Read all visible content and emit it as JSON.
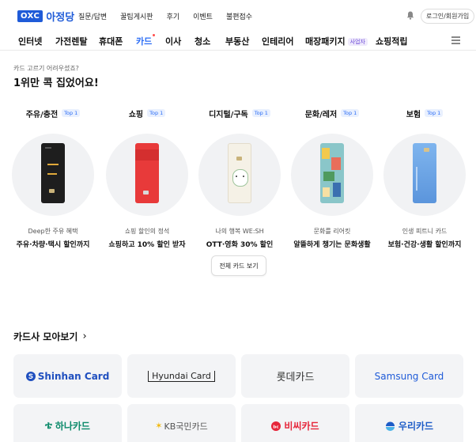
{
  "header": {
    "logo_mark": "OXC",
    "logo_name": "아정당",
    "nav": [
      "질문/답변",
      "꿀팁게시판",
      "후기",
      "이벤트",
      "불편접수"
    ],
    "login_label": "로그인/회원가입"
  },
  "categories": [
    {
      "label": "인터넷"
    },
    {
      "label": "가전렌탈"
    },
    {
      "label": "휴대폰"
    },
    {
      "label": "카드"
    },
    {
      "label": "이사"
    },
    {
      "label": "청소"
    },
    {
      "label": "부동산"
    },
    {
      "label": "인테리어"
    },
    {
      "label": "매장패키지",
      "badge": "사업자"
    },
    {
      "label": "쇼핑적립"
    }
  ],
  "intro": {
    "sub": "카드 고르기 어려우셨죠?",
    "headline": "1위만 콕 집었어요!"
  },
  "top_badge": "Top 1",
  "cards": [
    {
      "category": "주유/충전",
      "desc": "Deep한 주유 혜택",
      "name": "주유·차량·택시 할인까지",
      "card_color": "#1e1e1e"
    },
    {
      "category": "쇼핑",
      "desc": "쇼핑 할인의 정석",
      "name": "쇼핑하고 10% 할인 받자",
      "card_color": "#e83a3a"
    },
    {
      "category": "디지털/구독",
      "desc": "나의 행복 WE:SH",
      "name": "OTT·영화 30% 할인",
      "card_color": "#f5f1e6"
    },
    {
      "category": "문화/레저",
      "desc": "문화를 리어킷",
      "name": "알뜰하게 챙기는 문화생활",
      "card_color": "#8ac6c9"
    },
    {
      "category": "보험",
      "desc": "인생 피트니 카드",
      "name": "보험·건강·생활 할인까지",
      "card_color": "#6fa6e6"
    }
  ],
  "all_cards_button": "전체 카드 보기",
  "issuers_title": "카드사 모아보기",
  "issuers": [
    {
      "name": "Shinhan Card",
      "color": "#1f4fbf"
    },
    {
      "name": "Hyundai Card",
      "color": "#222222"
    },
    {
      "name": "롯데카드",
      "color": "#333333"
    },
    {
      "name": "Samsung Card",
      "color": "#1f5bd8"
    },
    {
      "name": "하나카드",
      "color": "#0b8a6a"
    },
    {
      "name": "KB국민카드",
      "color": "#555555"
    },
    {
      "name": "비씨카드",
      "color": "#e6263a"
    },
    {
      "name": "우리카드",
      "color": "#1d5cc7"
    }
  ]
}
